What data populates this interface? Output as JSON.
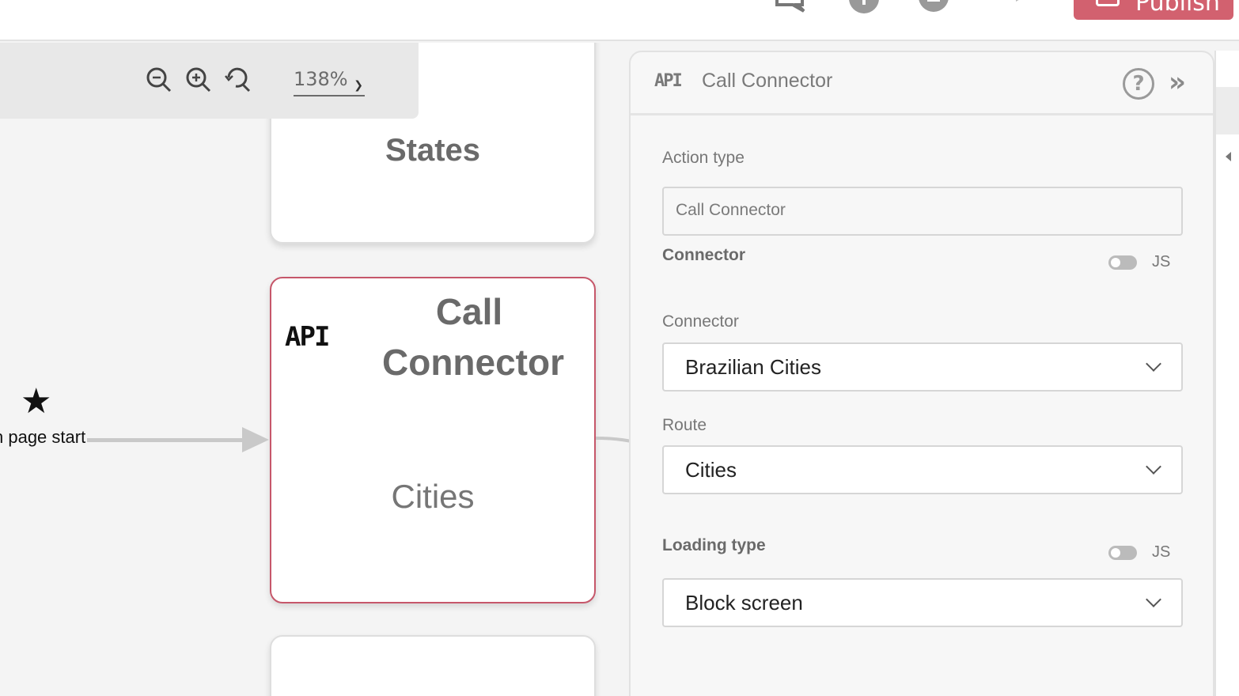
{
  "topbar": {
    "publish_label": "Publish",
    "icons": [
      "comment-icon",
      "info-icon",
      "stop-icon",
      "play-icon",
      "publish-icon"
    ]
  },
  "canvas": {
    "zoom_level": "138%",
    "zoom_icons": [
      "zoom-out-icon",
      "zoom-in-icon",
      "zoom-reset-icon"
    ],
    "start_label": "n page start",
    "nodes": {
      "top_title": "States",
      "mid_tag": "API",
      "mid_title_line1": "Call",
      "mid_title_line2": "Connector",
      "mid_subtitle": "Cities"
    }
  },
  "panel": {
    "api_tag": "API",
    "title": "Call Connector",
    "action_type_label": "Action type",
    "action_type_value": "Call Connector",
    "connector_section_label": "Connector",
    "js_label": "JS",
    "connector_label": "Connector",
    "connector_value": "Brazilian Cities",
    "route_label": "Route",
    "route_value": "Cities",
    "loading_type_label": "Loading type",
    "loading_js_label": "JS",
    "loading_type_value": "Block screen"
  },
  "colors": {
    "accent": "#d2616f",
    "selected_node_border": "#c6576a"
  }
}
